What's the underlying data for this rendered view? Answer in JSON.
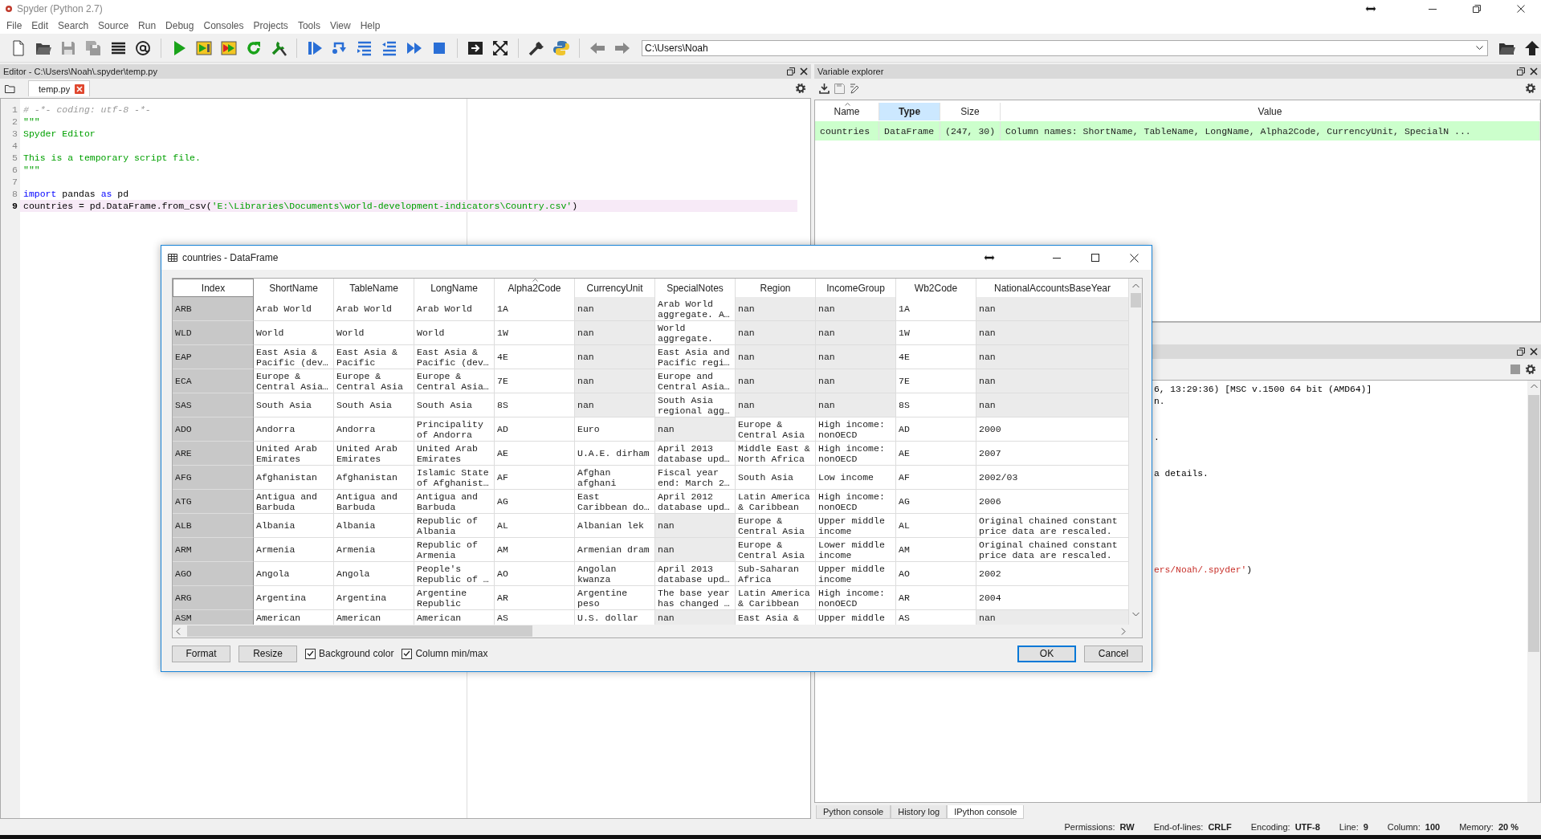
{
  "window": {
    "title": "Spyder (Python 2.7)"
  },
  "menu": [
    "File",
    "Edit",
    "Search",
    "Source",
    "Run",
    "Debug",
    "Consoles",
    "Projects",
    "Tools",
    "View",
    "Help"
  ],
  "path_field": {
    "value": "C:\\Users\\Noah"
  },
  "editor": {
    "title": "Editor - C:\\Users\\Noah\\.spyder\\temp.py",
    "tabs": [
      {
        "label": "temp.py",
        "selected": true
      }
    ],
    "lines": [
      {
        "number": "1",
        "current": false,
        "segments": [
          {
            "text": "# -*- coding: utf-8 -*-",
            "kind": "comment"
          }
        ]
      },
      {
        "number": "2",
        "current": false,
        "segments": [
          {
            "text": "\"\"\"",
            "kind": "string"
          }
        ]
      },
      {
        "number": "3",
        "current": false,
        "segments": [
          {
            "text": "Spyder Editor",
            "kind": "string"
          }
        ]
      },
      {
        "number": "4",
        "current": false
      },
      {
        "number": "5",
        "current": false,
        "segments": [
          {
            "text": "This is a temporary script file.",
            "kind": "string"
          }
        ]
      },
      {
        "number": "6",
        "current": false,
        "segments": [
          {
            "text": "\"\"\"",
            "kind": "string"
          }
        ]
      },
      {
        "number": "7",
        "current": false
      },
      {
        "number": "8",
        "current": false,
        "segments": [
          {
            "text": "import",
            "kind": "keyword"
          },
          {
            "text": " pandas ",
            "kind": "plain"
          },
          {
            "text": "as",
            "kind": "keyword"
          },
          {
            "text": " pd",
            "kind": "plain"
          }
        ]
      },
      {
        "number": "9",
        "current": true,
        "segments": [
          {
            "text": "countries = pd.DataFrame.from_csv(",
            "kind": "plain"
          },
          {
            "text": "'E:\\Libraries\\Documents\\world-development-indicators\\Country.csv'",
            "kind": "string"
          },
          {
            "text": ")",
            "kind": "plain"
          }
        ]
      }
    ]
  },
  "variable_explorer": {
    "title": "Variable explorer",
    "columns": [
      {
        "label": "Name",
        "selected": false,
        "sorted": true
      },
      {
        "label": "Type",
        "selected": true,
        "sorted": false
      },
      {
        "label": "Size",
        "selected": false,
        "sorted": false
      },
      {
        "label": "Value",
        "selected": false,
        "sorted": false
      }
    ],
    "rows": [
      {
        "color": "#ccffcc",
        "cells": [
          "countries",
          "DataFrame",
          "(247, 30)",
          "Column names: ShortName, TableName, LongName, Alpha2Code, CurrencyUnit, SpecialN ..."
        ]
      }
    ]
  },
  "console": {
    "lines": [
      {
        "kind": "text",
        "segments": [
          {
            "text": "6, 13:29:36) [MSC v.1500 64 bit (AMD64)]",
            "kind": "plain"
          }
        ]
      },
      {
        "kind": "text",
        "segments": [
          {
            "text": "n.",
            "kind": "plain"
          }
        ]
      },
      {
        "kind": "blank"
      },
      {
        "kind": "blank"
      },
      {
        "kind": "text",
        "segments": [
          {
            "text": ".",
            "kind": "plain"
          }
        ]
      },
      {
        "kind": "blank"
      },
      {
        "kind": "blank"
      },
      {
        "kind": "text",
        "segments": [
          {
            "text": "a details.",
            "kind": "plain"
          }
        ]
      },
      {
        "kind": "blank"
      },
      {
        "kind": "blank"
      },
      {
        "kind": "blank"
      },
      {
        "kind": "blank"
      },
      {
        "kind": "blank"
      },
      {
        "kind": "blank"
      },
      {
        "kind": "blank"
      },
      {
        "kind": "text",
        "segments": [
          {
            "text": "ers/Noah/.spyder'",
            "kind": "string"
          },
          {
            "text": ")",
            "kind": "plain"
          }
        ]
      }
    ]
  },
  "console_tabs": [
    {
      "label": "Python console",
      "selected": false
    },
    {
      "label": "History log",
      "selected": false
    },
    {
      "label": "IPython console",
      "selected": true
    }
  ],
  "status_bar": [
    {
      "label": "Permissions:",
      "value": "RW"
    },
    {
      "label": "End-of-lines:",
      "value": "CRLF"
    },
    {
      "label": "Encoding:",
      "value": "UTF-8"
    },
    {
      "label": "Line:",
      "value": "9"
    },
    {
      "label": "Column:",
      "value": "100"
    },
    {
      "label": "Memory:",
      "value": "20 %"
    }
  ],
  "dialog": {
    "title": "countries - DataFrame",
    "index_header": "Index",
    "columns": [
      {
        "label": "ShortName",
        "sorted": false
      },
      {
        "label": "TableName",
        "sorted": false
      },
      {
        "label": "LongName",
        "sorted": false
      },
      {
        "label": "Alpha2Code",
        "sorted": true
      },
      {
        "label": "CurrencyUnit",
        "sorted": false
      },
      {
        "label": "SpecialNotes",
        "sorted": false
      },
      {
        "label": "Region",
        "sorted": false
      },
      {
        "label": "IncomeGroup",
        "sorted": false
      },
      {
        "label": "Wb2Code",
        "sorted": false
      },
      {
        "label": "NationalAccountsBaseYear",
        "sorted": false
      }
    ],
    "rows": [
      {
        "index": "ARB",
        "cells": [
          {
            "text": "Arab World",
            "shaded": false
          },
          {
            "text": "Arab World",
            "shaded": false
          },
          {
            "text": "Arab World",
            "shaded": false
          },
          {
            "text": "1A",
            "shaded": false
          },
          {
            "text": "nan",
            "shaded": true
          },
          {
            "text": "Arab World\naggregate. A…",
            "shaded": false
          },
          {
            "text": "nan",
            "shaded": true
          },
          {
            "text": "nan",
            "shaded": true
          },
          {
            "text": "1A",
            "shaded": false
          },
          {
            "text": "nan",
            "shaded": true
          }
        ]
      },
      {
        "index": "WLD",
        "cells": [
          {
            "text": "World",
            "shaded": false
          },
          {
            "text": "World",
            "shaded": false
          },
          {
            "text": "World",
            "shaded": false
          },
          {
            "text": "1W",
            "shaded": false
          },
          {
            "text": "nan",
            "shaded": true
          },
          {
            "text": "World\naggregate.",
            "shaded": false
          },
          {
            "text": "nan",
            "shaded": true
          },
          {
            "text": "nan",
            "shaded": true
          },
          {
            "text": "1W",
            "shaded": false
          },
          {
            "text": "nan",
            "shaded": true
          }
        ]
      },
      {
        "index": "EAP",
        "cells": [
          {
            "text": "East Asia &\nPacific (dev…",
            "shaded": false
          },
          {
            "text": "East Asia &\nPacific",
            "shaded": false
          },
          {
            "text": "East Asia &\nPacific (dev…",
            "shaded": false
          },
          {
            "text": "4E",
            "shaded": false
          },
          {
            "text": "nan",
            "shaded": true
          },
          {
            "text": "East Asia and\nPacific regi…",
            "shaded": false
          },
          {
            "text": "nan",
            "shaded": true
          },
          {
            "text": "nan",
            "shaded": true
          },
          {
            "text": "4E",
            "shaded": false
          },
          {
            "text": "nan",
            "shaded": true
          }
        ]
      },
      {
        "index": "ECA",
        "cells": [
          {
            "text": "Europe &\nCentral Asia…",
            "shaded": false
          },
          {
            "text": "Europe &\nCentral Asia",
            "shaded": false
          },
          {
            "text": "Europe &\nCentral Asia…",
            "shaded": false
          },
          {
            "text": "7E",
            "shaded": false
          },
          {
            "text": "nan",
            "shaded": true
          },
          {
            "text": "Europe and\nCentral Asia…",
            "shaded": false
          },
          {
            "text": "nan",
            "shaded": true
          },
          {
            "text": "nan",
            "shaded": true
          },
          {
            "text": "7E",
            "shaded": false
          },
          {
            "text": "nan",
            "shaded": true
          }
        ]
      },
      {
        "index": "SAS",
        "cells": [
          {
            "text": "South Asia",
            "shaded": false
          },
          {
            "text": "South Asia",
            "shaded": false
          },
          {
            "text": "South Asia",
            "shaded": false
          },
          {
            "text": "8S",
            "shaded": false
          },
          {
            "text": "nan",
            "shaded": true
          },
          {
            "text": "South Asia\nregional agg…",
            "shaded": false
          },
          {
            "text": "nan",
            "shaded": true
          },
          {
            "text": "nan",
            "shaded": true
          },
          {
            "text": "8S",
            "shaded": false
          },
          {
            "text": "nan",
            "shaded": true
          }
        ]
      },
      {
        "index": "ADO",
        "cells": [
          {
            "text": "Andorra",
            "shaded": false
          },
          {
            "text": "Andorra",
            "shaded": false
          },
          {
            "text": "Principality\nof Andorra",
            "shaded": false
          },
          {
            "text": "AD",
            "shaded": false
          },
          {
            "text": "Euro",
            "shaded": false
          },
          {
            "text": "nan",
            "shaded": true
          },
          {
            "text": "Europe &\nCentral Asia",
            "shaded": false
          },
          {
            "text": "High income:\nnonOECD",
            "shaded": false
          },
          {
            "text": "AD",
            "shaded": false
          },
          {
            "text": "2000",
            "shaded": false
          }
        ]
      },
      {
        "index": "ARE",
        "cells": [
          {
            "text": "United Arab\nEmirates",
            "shaded": false
          },
          {
            "text": "United Arab\nEmirates",
            "shaded": false
          },
          {
            "text": "United Arab\nEmirates",
            "shaded": false
          },
          {
            "text": "AE",
            "shaded": false
          },
          {
            "text": "U.A.E. dirham",
            "shaded": false
          },
          {
            "text": "April 2013\ndatabase upd…",
            "shaded": false
          },
          {
            "text": "Middle East &\nNorth Africa",
            "shaded": false
          },
          {
            "text": "High income:\nnonOECD",
            "shaded": false
          },
          {
            "text": "AE",
            "shaded": false
          },
          {
            "text": "2007",
            "shaded": false
          }
        ]
      },
      {
        "index": "AFG",
        "cells": [
          {
            "text": "Afghanistan",
            "shaded": false
          },
          {
            "text": "Afghanistan",
            "shaded": false
          },
          {
            "text": "Islamic State\nof Afghanist…",
            "shaded": false
          },
          {
            "text": "AF",
            "shaded": false
          },
          {
            "text": "Afghan\nafghani",
            "shaded": false
          },
          {
            "text": "Fiscal year\nend: March 2…",
            "shaded": false
          },
          {
            "text": "South Asia",
            "shaded": false
          },
          {
            "text": "Low income",
            "shaded": false
          },
          {
            "text": "AF",
            "shaded": false
          },
          {
            "text": "2002/03",
            "shaded": false
          }
        ]
      },
      {
        "index": "ATG",
        "cells": [
          {
            "text": "Antigua and\nBarbuda",
            "shaded": false
          },
          {
            "text": "Antigua and\nBarbuda",
            "shaded": false
          },
          {
            "text": "Antigua and\nBarbuda",
            "shaded": false
          },
          {
            "text": "AG",
            "shaded": false
          },
          {
            "text": "East\nCaribbean do…",
            "shaded": false
          },
          {
            "text": "April 2012\ndatabase upd…",
            "shaded": false
          },
          {
            "text": "Latin America\n& Caribbean",
            "shaded": false
          },
          {
            "text": "High income:\nnonOECD",
            "shaded": false
          },
          {
            "text": "AG",
            "shaded": false
          },
          {
            "text": "2006",
            "shaded": false
          }
        ]
      },
      {
        "index": "ALB",
        "cells": [
          {
            "text": "Albania",
            "shaded": false
          },
          {
            "text": "Albania",
            "shaded": false
          },
          {
            "text": "Republic of\nAlbania",
            "shaded": false
          },
          {
            "text": "AL",
            "shaded": false
          },
          {
            "text": "Albanian lek",
            "shaded": false
          },
          {
            "text": "nan",
            "shaded": true
          },
          {
            "text": "Europe &\nCentral Asia",
            "shaded": false
          },
          {
            "text": "Upper middle\nincome",
            "shaded": false
          },
          {
            "text": "AL",
            "shaded": false
          },
          {
            "text": "Original chained constant\nprice data are rescaled.",
            "shaded": false
          }
        ]
      },
      {
        "index": "ARM",
        "cells": [
          {
            "text": "Armenia",
            "shaded": false
          },
          {
            "text": "Armenia",
            "shaded": false
          },
          {
            "text": "Republic of\nArmenia",
            "shaded": false
          },
          {
            "text": "AM",
            "shaded": false
          },
          {
            "text": "Armenian dram",
            "shaded": false
          },
          {
            "text": "nan",
            "shaded": true
          },
          {
            "text": "Europe &\nCentral Asia",
            "shaded": false
          },
          {
            "text": "Lower middle\nincome",
            "shaded": false
          },
          {
            "text": "AM",
            "shaded": false
          },
          {
            "text": "Original chained constant\nprice data are rescaled.",
            "shaded": false
          }
        ]
      },
      {
        "index": "AGO",
        "cells": [
          {
            "text": "Angola",
            "shaded": false
          },
          {
            "text": "Angola",
            "shaded": false
          },
          {
            "text": "People's\nRepublic of …",
            "shaded": false
          },
          {
            "text": "AO",
            "shaded": false
          },
          {
            "text": "Angolan\nkwanza",
            "shaded": false
          },
          {
            "text": "April 2013\ndatabase upd…",
            "shaded": false
          },
          {
            "text": "Sub-Saharan\nAfrica",
            "shaded": false
          },
          {
            "text": "Upper middle\nincome",
            "shaded": false
          },
          {
            "text": "AO",
            "shaded": false
          },
          {
            "text": "2002",
            "shaded": false
          }
        ]
      },
      {
        "index": "ARG",
        "cells": [
          {
            "text": "Argentina",
            "shaded": false
          },
          {
            "text": "Argentina",
            "shaded": false
          },
          {
            "text": "Argentine\nRepublic",
            "shaded": false
          },
          {
            "text": "AR",
            "shaded": false
          },
          {
            "text": "Argentine\npeso",
            "shaded": false
          },
          {
            "text": "The base year\nhas changed …",
            "shaded": false
          },
          {
            "text": "Latin America\n& Caribbean",
            "shaded": false
          },
          {
            "text": "High income:\nnonOECD",
            "shaded": false
          },
          {
            "text": "AR",
            "shaded": false
          },
          {
            "text": "2004",
            "shaded": false
          }
        ]
      },
      {
        "index": "ASM",
        "cells": [
          {
            "text": "American",
            "shaded": false
          },
          {
            "text": "American",
            "shaded": false
          },
          {
            "text": "American",
            "shaded": false
          },
          {
            "text": "AS",
            "shaded": false
          },
          {
            "text": "U.S. dollar",
            "shaded": false
          },
          {
            "text": "nan",
            "shaded": true
          },
          {
            "text": "East Asia &",
            "shaded": false
          },
          {
            "text": "Upper middle",
            "shaded": false
          },
          {
            "text": "AS",
            "shaded": false
          },
          {
            "text": "nan",
            "shaded": true
          }
        ]
      }
    ],
    "buttons_left": [
      "Format",
      "Resize"
    ],
    "checkboxes": [
      {
        "label": "Background color",
        "checked": true
      },
      {
        "label": "Column min/max",
        "checked": true
      }
    ],
    "buttons_right": [
      {
        "label": "OK",
        "default": true
      },
      {
        "label": "Cancel",
        "default": false
      }
    ]
  }
}
